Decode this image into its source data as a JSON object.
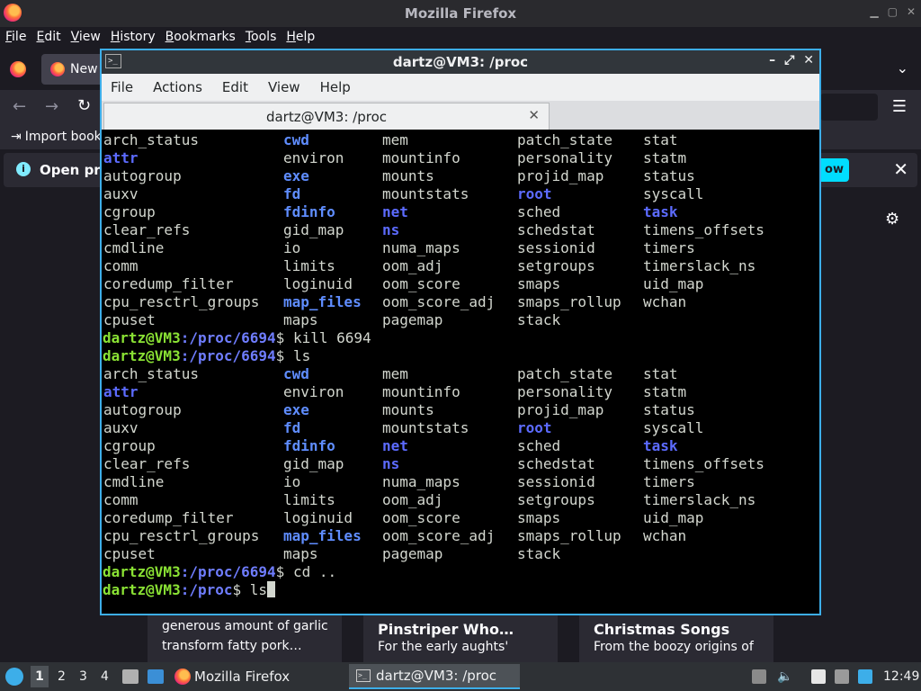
{
  "firefox": {
    "title": "Mozilla Firefox",
    "menu": [
      "File",
      "Edit",
      "View",
      "History",
      "Bookmarks",
      "Tools",
      "Help"
    ],
    "tab_label": "New",
    "import_label": "Import book",
    "notice_text": "Open pre",
    "notice_button": "ow",
    "cards": [
      {
        "title": "",
        "desc1": "generous amount of garlic",
        "desc2": "transform fatty pork…"
      },
      {
        "title": "Pinstriper Who…",
        "desc1": "For the early aughts'"
      },
      {
        "title": "Christmas Songs",
        "desc1": "From the boozy origins of"
      }
    ]
  },
  "terminal": {
    "title": "dartz@VM3: /proc",
    "menu": [
      "File",
      "Actions",
      "Edit",
      "View",
      "Help"
    ],
    "tab_title": "dartz@VM3: /proc",
    "listing": [
      [
        "arch_status",
        "cwd",
        "mem",
        "patch_state",
        "stat"
      ],
      [
        "attr",
        "environ",
        "mountinfo",
        "personality",
        "statm"
      ],
      [
        "autogroup",
        "exe",
        "mounts",
        "projid_map",
        "status"
      ],
      [
        "auxv",
        "fd",
        "mountstats",
        "root",
        "syscall"
      ],
      [
        "cgroup",
        "fdinfo",
        "net",
        "sched",
        "task"
      ],
      [
        "clear_refs",
        "gid_map",
        "ns",
        "schedstat",
        "timens_offsets"
      ],
      [
        "cmdline",
        "io",
        "numa_maps",
        "sessionid",
        "timers"
      ],
      [
        "comm",
        "limits",
        "oom_adj",
        "setgroups",
        "timerslack_ns"
      ],
      [
        "coredump_filter",
        "loginuid",
        "oom_score",
        "smaps",
        "uid_map"
      ],
      [
        "cpu_resctrl_groups",
        "map_files",
        "oom_score_adj",
        "smaps_rollup",
        "wchan"
      ],
      [
        "cpuset",
        "maps",
        "pagemap",
        "stack",
        ""
      ]
    ],
    "prompt_user": "dartz@VM3",
    "path_pid": ":/proc/6694",
    "path_proc": ":/proc",
    "cmd_kill": "$ kill 6694",
    "cmd_ls": "$ ls",
    "cmd_cd": "$ cd ..",
    "cmd_ls2": "$ ls"
  },
  "taskbar": {
    "workspaces": [
      "1",
      "2",
      "3",
      "4"
    ],
    "firefox_label": "Mozilla Firefox",
    "terminal_label": "dartz@VM3: /proc",
    "clock": "12:49"
  }
}
